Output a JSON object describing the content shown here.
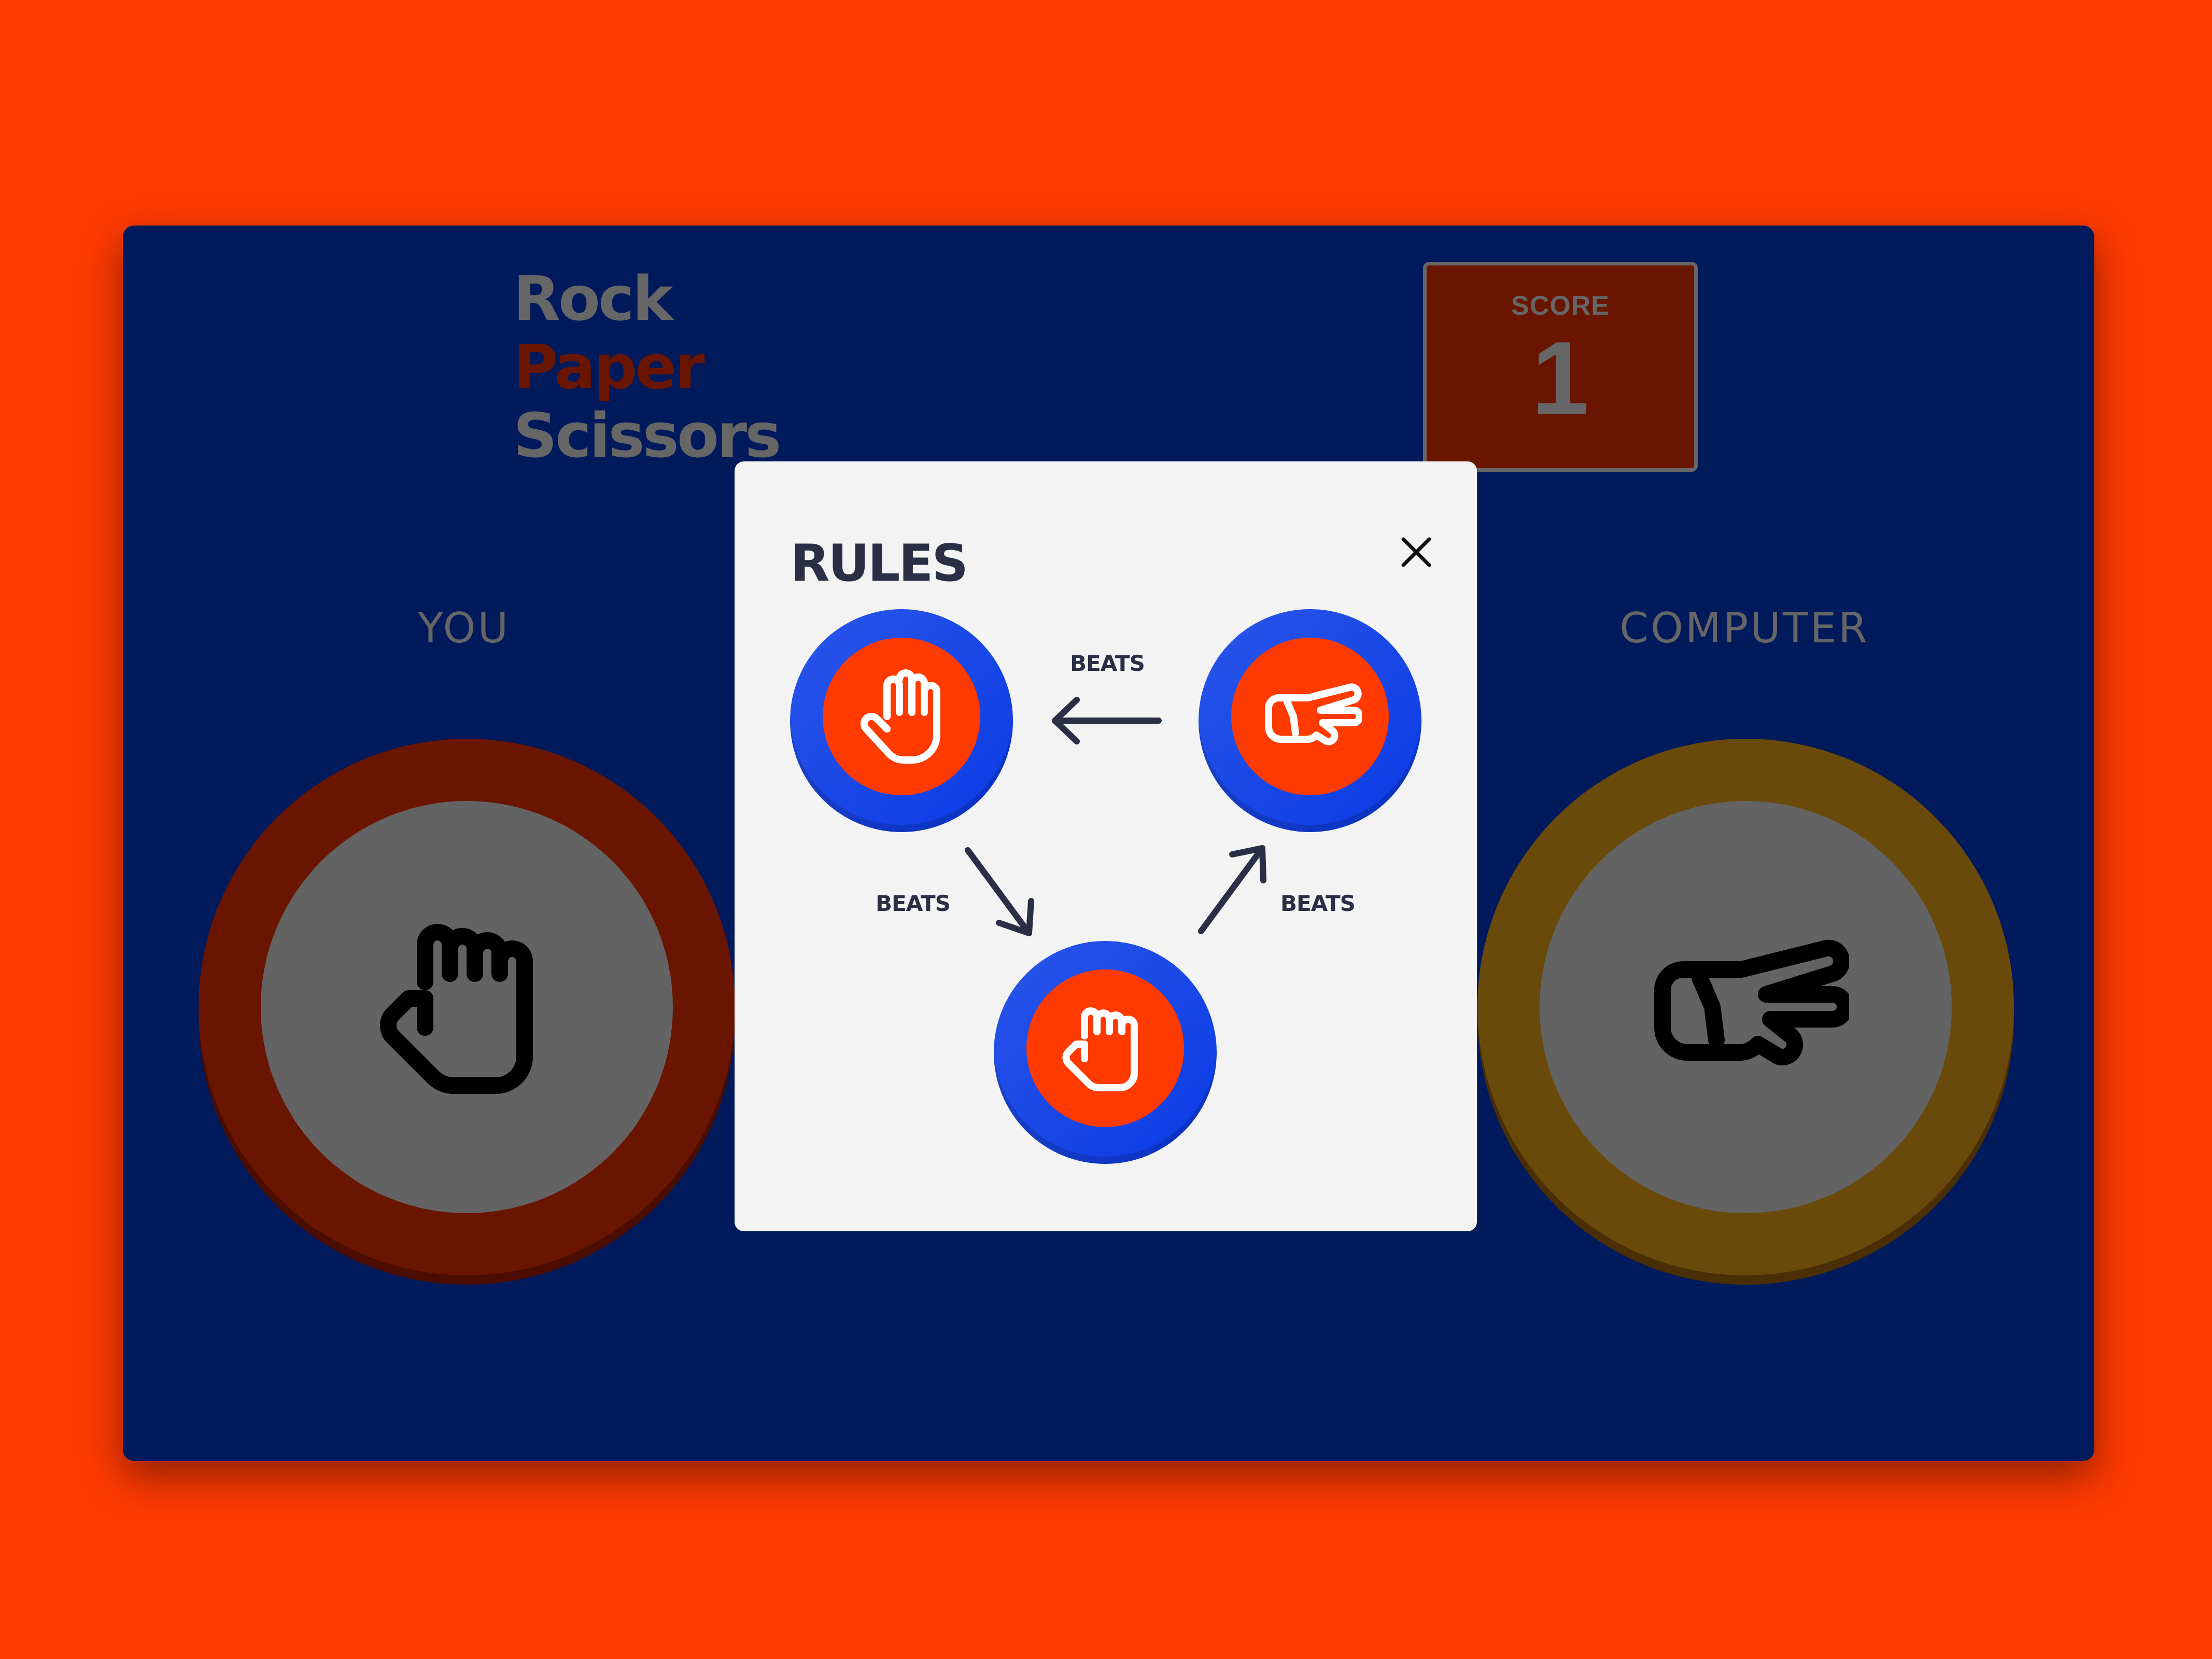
{
  "logo": {
    "line1": "Rock",
    "line2": "Paper",
    "line3": "Scissors"
  },
  "score": {
    "label": "SCORE",
    "value": "1"
  },
  "players": {
    "you_label": "YOU",
    "computer_label": "COMPUTER"
  },
  "you_choice": {
    "icon": "rock-icon",
    "ring_color": "#6a1500"
  },
  "computer_choice": {
    "icon": "scissors-icon",
    "ring_color": "#6a4a0a"
  },
  "rules_modal": {
    "title": "RULES",
    "close_icon": "close-icon",
    "beats_top": "BEATS",
    "beats_left": "BEATS",
    "beats_right": "BEATS",
    "chips": [
      "paper",
      "scissors",
      "rock"
    ]
  },
  "colors": {
    "background": "#ff3a00",
    "board": "#001a5c",
    "chip_ring": "#1f4ae8",
    "chip_fill": "#ff3a00",
    "dimmed_text": "#666666"
  }
}
